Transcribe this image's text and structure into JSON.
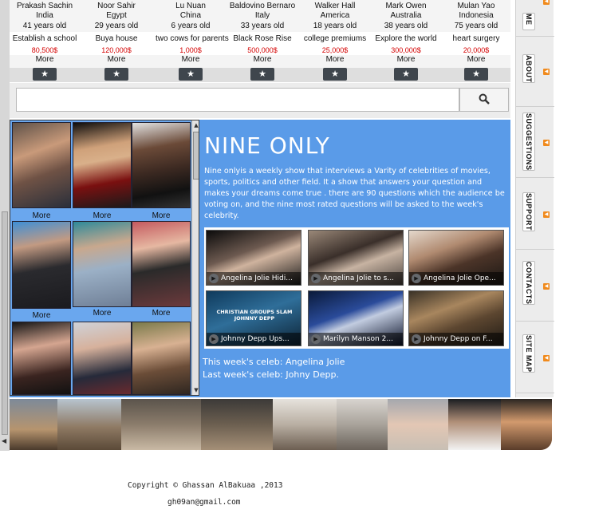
{
  "people": [
    {
      "name": "Prakash  Sachin",
      "country": "India",
      "age": "41 years old",
      "wish": "Establish a school",
      "amount": "80,500$",
      "more": "More"
    },
    {
      "name": "Noor  Sahir",
      "country": "Egypt",
      "age": "29 years old",
      "wish": "Buya house",
      "amount": "120,000$",
      "more": "More"
    },
    {
      "name": "Lu  Nuan",
      "country": "China",
      "age": "6 years old",
      "wish": "two cows for parents",
      "amount": "1,000$",
      "more": "More"
    },
    {
      "name": "Baldovino  Bernaro",
      "country": "Italy",
      "age": "33 years old",
      "wish": "Black Rose Rise",
      "amount": "500,000$",
      "more": "More"
    },
    {
      "name": "Walker  Hall",
      "country": "America",
      "age": "18 years old",
      "wish": "college premiums",
      "amount": "25,000$",
      "more": "More"
    },
    {
      "name": "Mark Owen",
      "country": "Australia",
      "age": "38 years old",
      "wish": "Explore the world",
      "amount": "300,000$",
      "more": "More"
    },
    {
      "name": "Mulan Yao",
      "country": "Indonesia",
      "age": "75 years old",
      "wish": "heart surgery",
      "amount": "20,000$",
      "more": "More"
    }
  ],
  "star_glyph": "★",
  "search": {
    "placeholder": "",
    "icon": "search-icon"
  },
  "nav": [
    {
      "label": "HOME",
      "visible": "ME"
    },
    {
      "label": "ABOUT"
    },
    {
      "label": "SUGGESTIONS"
    },
    {
      "label": "SUPPORT"
    },
    {
      "label": "CONTACTS"
    },
    {
      "label": "SITE MAP"
    }
  ],
  "celebs": {
    "more_label": "More",
    "photos": [
      "zac-efron",
      "scarlett-johansson",
      "barack-obama",
      "nicolas-cage",
      "bill-gates",
      "jackie-chan",
      "megan-fox",
      "jacques-chirac",
      "david-beckham"
    ]
  },
  "show": {
    "title": "NINE ONLY",
    "description": "Nine onlyis a weekly show that interviews a Varity of celebrities of movies, sports, politics and other field. It a show that answers your question and makes your dreams come true . there are 90 questions which the audience be voting on, and the nine most rated questions will be asked to the week's celebrity.",
    "videos": [
      {
        "caption": "Angelina Jolie Hidi..."
      },
      {
        "caption": "Angelina Jolie to s..."
      },
      {
        "caption": "Angelina Jolie Ope..."
      },
      {
        "caption": "Johnny Depp Ups...",
        "overlay": "CHRISTIAN GROUPS SLAM JOHNNY DEPP"
      },
      {
        "caption": "Marilyn Manson 2..."
      },
      {
        "caption": "Johnny Depp on F..."
      }
    ],
    "this_week": "This week's celeb: Angelina Jolie",
    "last_week": "Last week's celeb: Johny Depp."
  },
  "footer": {
    "copyright": "Copyright © Ghassan AlBakuaa ,2013",
    "email": "gh09an@gmail.com"
  },
  "colors": {
    "accent": "#5a9be8",
    "amount_red": "#d40000",
    "nav_dot": "#f08a1d"
  }
}
